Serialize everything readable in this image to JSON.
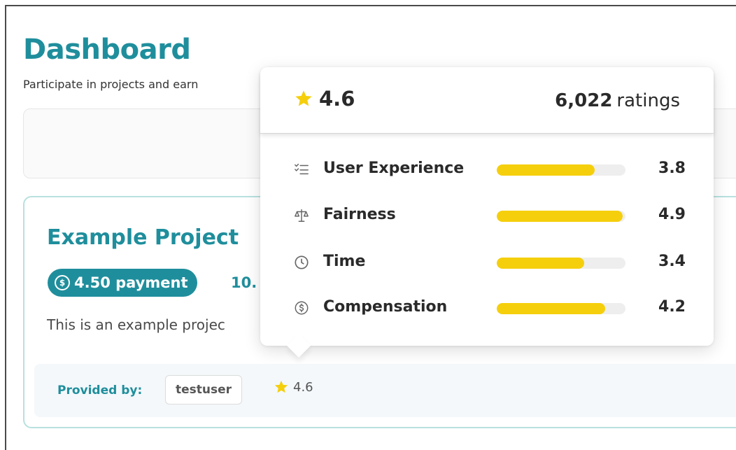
{
  "dashboard": {
    "title": "Dashboard",
    "subtitle": "Participate in projects and earn"
  },
  "project": {
    "title": "Example Project",
    "payment_label": "4.50 payment",
    "extra_badge": "10.",
    "description": "This is an example projec",
    "provided_by_label": "Provided by:",
    "provider": "testuser",
    "rating": "4.6"
  },
  "rating_popover": {
    "score": "4.6",
    "count": "6,022",
    "count_suffix": "ratings",
    "categories": [
      {
        "label": "User Experience",
        "value": "3.8",
        "icon": "list-check-icon"
      },
      {
        "label": "Fairness",
        "value": "4.9",
        "icon": "scale-icon"
      },
      {
        "label": "Time",
        "value": "3.4",
        "icon": "clock-icon"
      },
      {
        "label": "Compensation",
        "value": "4.2",
        "icon": "dollar-circle-icon"
      }
    ]
  },
  "colors": {
    "brand_teal": "#1f8e9c",
    "star_yellow": "#f5cf0c",
    "bar_track": "#eeeeee"
  }
}
